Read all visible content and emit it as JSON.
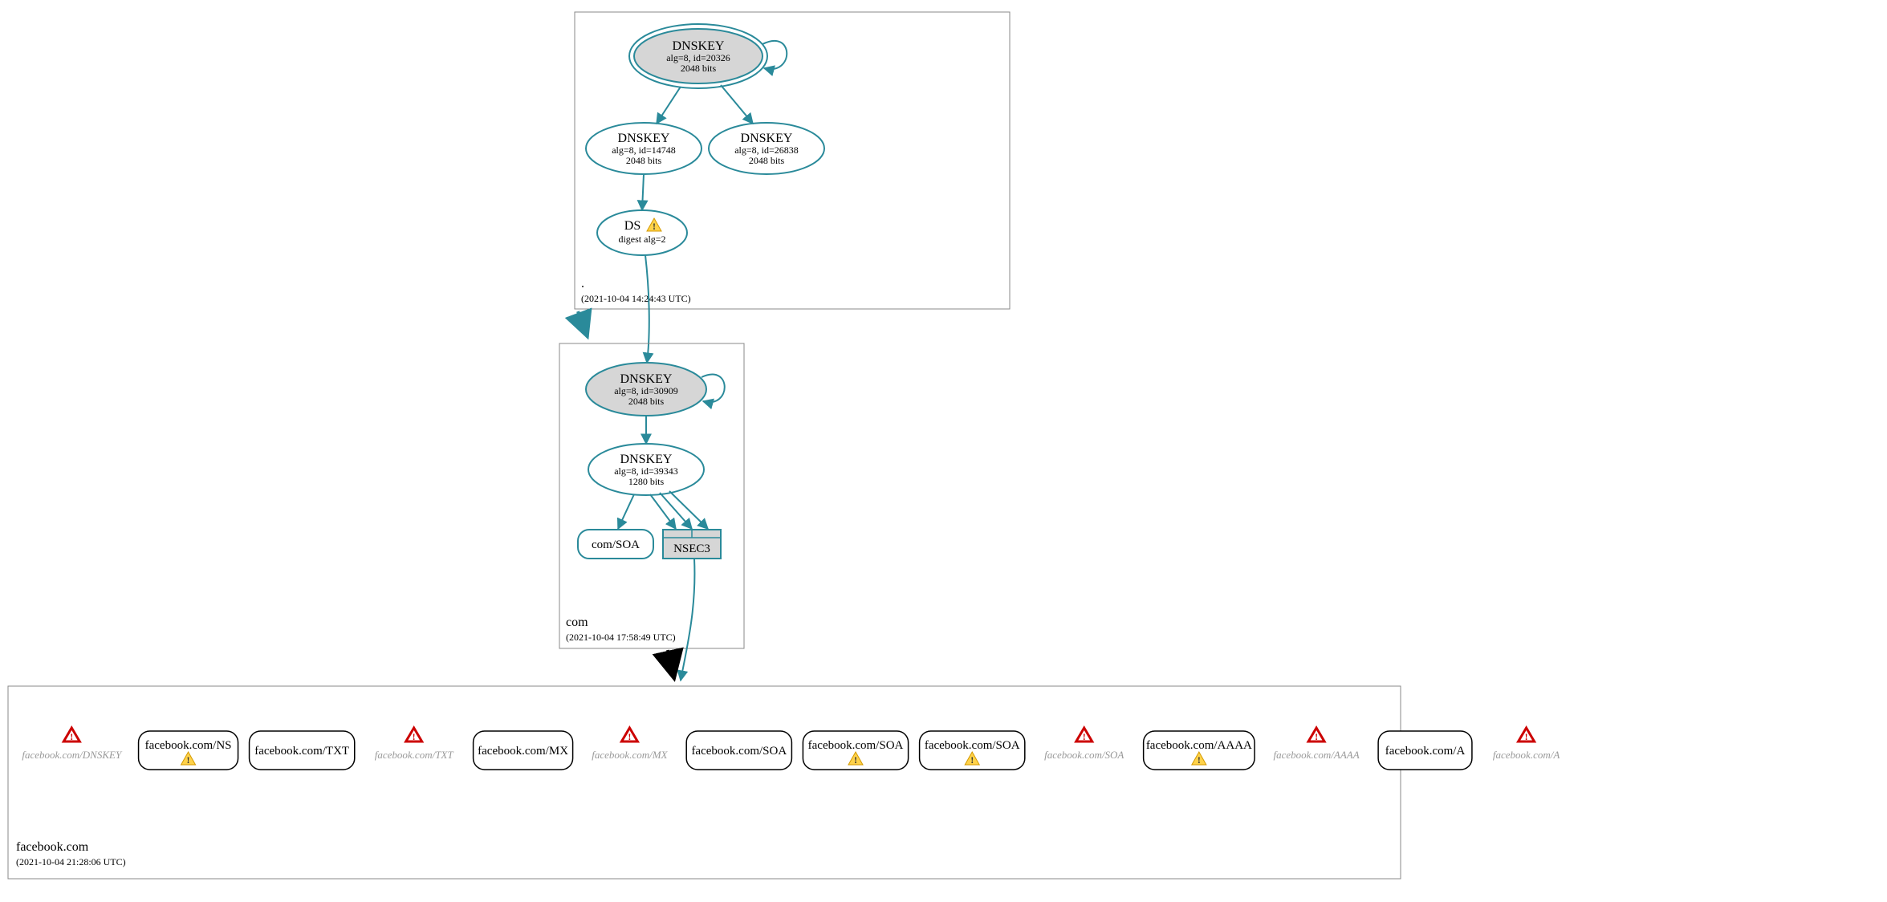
{
  "colors": {
    "teal": "#2a8a9a",
    "border": "#888",
    "grey_fill": "#d6d6d6",
    "light_text": "#999",
    "red": "#c00",
    "yellow": "#ffd24a",
    "yellow_stroke": "#d49a00"
  },
  "zones": {
    "root": {
      "label": ".",
      "timestamp": "(2021-10-04 14:24:43 UTC)"
    },
    "com": {
      "label": "com",
      "timestamp": "(2021-10-04 17:58:49 UTC)"
    },
    "fb": {
      "label": "facebook.com",
      "timestamp": "(2021-10-04 21:28:06 UTC)"
    }
  },
  "root": {
    "ksk": {
      "title": "DNSKEY",
      "line1": "alg=8, id=20326",
      "line2": "2048 bits"
    },
    "zsk1": {
      "title": "DNSKEY",
      "line1": "alg=8, id=14748",
      "line2": "2048 bits"
    },
    "zsk2": {
      "title": "DNSKEY",
      "line1": "alg=8, id=26838",
      "line2": "2048 bits"
    },
    "ds": {
      "title": "DS",
      "line1": "digest alg=2"
    }
  },
  "com": {
    "ksk": {
      "title": "DNSKEY",
      "line1": "alg=8, id=30909",
      "line2": "2048 bits"
    },
    "zsk": {
      "title": "DNSKEY",
      "line1": "alg=8, id=39343",
      "line2": "1280 bits"
    },
    "soa": {
      "label": "com/SOA"
    },
    "nsec3": {
      "label": "NSEC3"
    }
  },
  "fb_records": [
    {
      "kind": "err",
      "label": "facebook.com/DNSKEY"
    },
    {
      "kind": "rwarn",
      "label": "facebook.com/NS"
    },
    {
      "kind": "rect",
      "label": "facebook.com/TXT"
    },
    {
      "kind": "err",
      "label": "facebook.com/TXT"
    },
    {
      "kind": "rect",
      "label": "facebook.com/MX"
    },
    {
      "kind": "err",
      "label": "facebook.com/MX"
    },
    {
      "kind": "rect",
      "label": "facebook.com/SOA"
    },
    {
      "kind": "rwarn",
      "label": "facebook.com/SOA"
    },
    {
      "kind": "rwarn",
      "label": "facebook.com/SOA"
    },
    {
      "kind": "err",
      "label": "facebook.com/SOA"
    },
    {
      "kind": "rwarn",
      "label": "facebook.com/AAAA"
    },
    {
      "kind": "err",
      "label": "facebook.com/AAAA"
    },
    {
      "kind": "rect",
      "label": "facebook.com/A"
    },
    {
      "kind": "err",
      "label": "facebook.com/A"
    }
  ]
}
